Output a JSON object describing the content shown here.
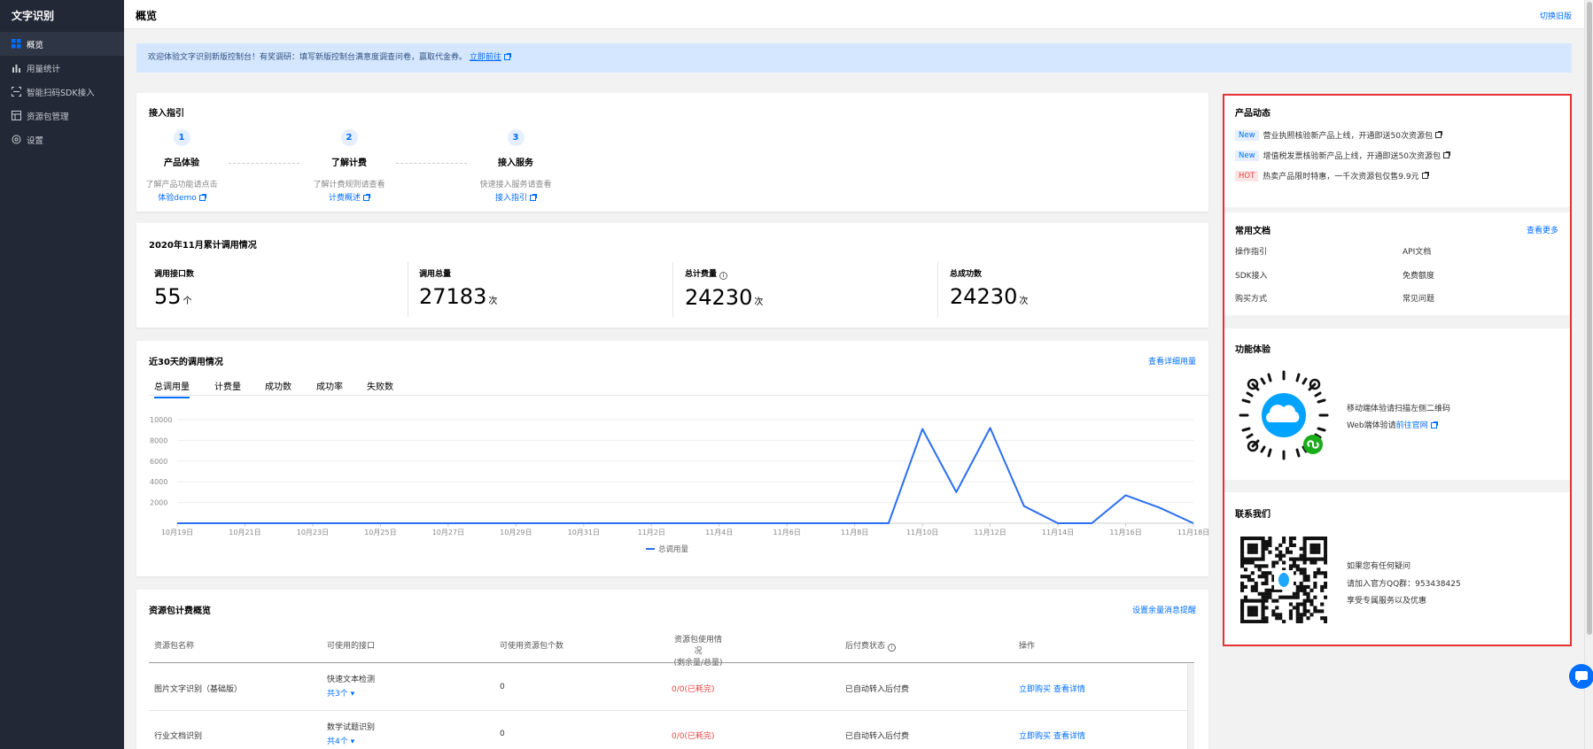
{
  "sidebar": {
    "title": "文字识别",
    "items": [
      {
        "label": "概览",
        "icon": "dashboard-icon",
        "active": true
      },
      {
        "label": "用量统计",
        "icon": "bar-chart-icon"
      },
      {
        "label": "智能扫码SDK接入",
        "icon": "scan-icon"
      },
      {
        "label": "资源包管理",
        "icon": "package-icon"
      },
      {
        "label": "设置",
        "icon": "gear-icon"
      }
    ]
  },
  "header": {
    "title": "概览",
    "switch_label": "切换旧版"
  },
  "banner": {
    "text": "欢迎体验文字识别新版控制台！有奖调研：填写新版控制台满意度调查问卷，赢取代金券。",
    "link": "立即前往"
  },
  "guide": {
    "title": "接入指引",
    "steps": [
      {
        "num": "1",
        "name": "产品体验",
        "desc": "了解产品功能请点击",
        "link": "体验demo"
      },
      {
        "num": "2",
        "name": "了解计费",
        "desc": "了解计费规则请查看",
        "link": "计费概述"
      },
      {
        "num": "3",
        "name": "接入服务",
        "desc": "快速接入服务请查看",
        "link": "接入指引"
      }
    ]
  },
  "stats": {
    "title": "2020年11月累计调用情况",
    "items": [
      {
        "label": "调用接口数",
        "value": "55",
        "unit": "个"
      },
      {
        "label": "调用总量",
        "value": "27183",
        "unit": "次"
      },
      {
        "label": "总计费量",
        "value": "24230",
        "unit": "次"
      },
      {
        "label": "总成功数",
        "value": "24230",
        "unit": "次"
      }
    ]
  },
  "usage": {
    "title": "近30天的调用情况",
    "detail_link": "查看详细用量",
    "tabs": [
      "总调用量",
      "计费量",
      "成功数",
      "成功率",
      "失败数"
    ],
    "active_tab": 0
  },
  "chart_data": {
    "type": "line",
    "title": "",
    "x": [
      "10月19日",
      "10月20日",
      "10月21日",
      "10月22日",
      "10月23日",
      "10月24日",
      "10月25日",
      "10月26日",
      "10月27日",
      "10月28日",
      "10月29日",
      "10月30日",
      "10月31日",
      "11月1日",
      "11月2日",
      "11月3日",
      "11月4日",
      "11月5日",
      "11月6日",
      "11月7日",
      "11月8日",
      "11月9日",
      "11月10日",
      "11月11日",
      "11月12日",
      "11月13日",
      "11月14日",
      "11月15日",
      "11月16日",
      "11月17日",
      "11月18日"
    ],
    "x_tick_labels": [
      "10月19日",
      "10月21日",
      "10月23日",
      "10月25日",
      "10月27日",
      "10月29日",
      "10月31日",
      "11月2日",
      "11月4日",
      "11月6日",
      "11月8日",
      "11月10日",
      "11月12日",
      "11月14日",
      "11月16日",
      "11月18日"
    ],
    "series": [
      {
        "name": "总调用量",
        "values": [
          0,
          0,
          0,
          0,
          0,
          0,
          0,
          0,
          0,
          0,
          0,
          0,
          0,
          0,
          0,
          0,
          0,
          0,
          0,
          0,
          0,
          0,
          9100,
          3000,
          9200,
          1650,
          0,
          0,
          2700,
          1500,
          0
        ],
        "color": "#2b6ff0"
      }
    ],
    "y_ticks": [
      2000,
      4000,
      6000,
      8000,
      10000
    ],
    "ylim": [
      0,
      10000
    ],
    "grid": true,
    "legend": "bottom"
  },
  "packages": {
    "title": "资源包计费概览",
    "remind_link": "设置余量消息提醒",
    "columns": [
      "资源包名称",
      "可使用的接口",
      "可使用资源包个数",
      "资源包使用情况",
      "(剩余量/总量)",
      "后付费状态",
      "操作"
    ],
    "rows": [
      {
        "name": "图片文字识别（基础版）",
        "api": "快速文本检测",
        "api_count": "共3个",
        "count": "0",
        "usage": "0/0(已耗完)",
        "status": "已自动转入后付费",
        "buy": "立即购买",
        "detail": "查看详情"
      },
      {
        "name": "行业文档识别",
        "api": "数学试题识别",
        "api_count": "共4个",
        "count": "0",
        "usage": "0/0(已耗完)",
        "status": "已自动转入后付费",
        "buy": "立即购买",
        "detail": "查看详情"
      }
    ]
  },
  "news": {
    "title": "产品动态",
    "items": [
      {
        "badge": "New",
        "text": "营业执照核验新产品上线，开通即送50次资源包"
      },
      {
        "badge": "New",
        "text": "增值税发票核验新产品上线，开通即送50次资源包"
      },
      {
        "badge": "HOT",
        "text": "热卖产品限时特惠，一千次资源包仅售9.9元"
      }
    ]
  },
  "docs": {
    "title": "常用文档",
    "more": "查看更多",
    "items": [
      "操作指引",
      "API文档",
      "SDK接入",
      "免费额度",
      "购买方式",
      "常见问题"
    ]
  },
  "experience": {
    "title": "功能体验",
    "line1": "移动端体验请扫描左侧二维码",
    "line2_prefix": "Web端体验请",
    "line2_link": "前往官网"
  },
  "contact": {
    "title": "联系我们",
    "line1": "如果您有任何疑问",
    "line2": "请加入官方QQ群：953438425",
    "line3": "享受专属服务以及优惠"
  }
}
